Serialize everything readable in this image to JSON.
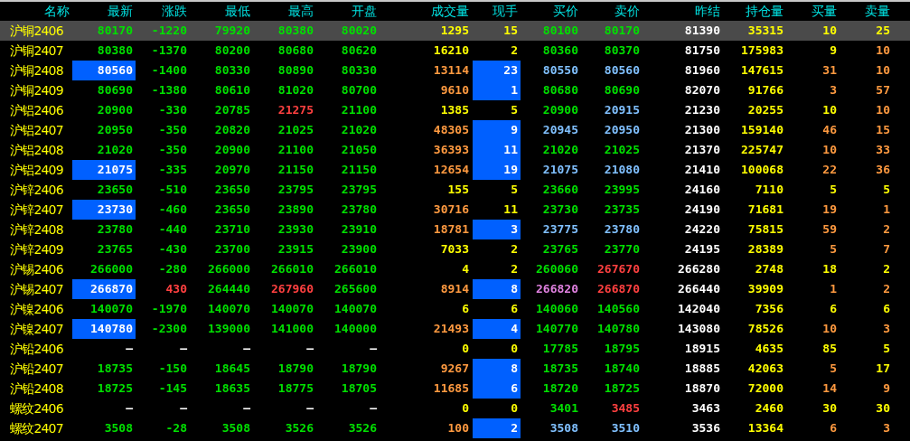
{
  "columns": [
    "名称",
    "最新",
    "涨跌",
    "最低",
    "最高",
    "开盘",
    "成交量",
    "现手",
    "买价",
    "卖价",
    "昨结",
    "持仓量",
    "买量",
    "卖量"
  ],
  "rows": [
    {
      "name": "沪铜2406",
      "selected": true,
      "flash_latest": false,
      "flash_volume": false,
      "cells": [
        {
          "text": "80170",
          "color": "#00e000"
        },
        {
          "text": "-1220",
          "color": "#00e000"
        },
        {
          "text": "79920",
          "color": "#00e000"
        },
        {
          "text": "80380",
          "color": "#00e000"
        },
        {
          "text": "80020",
          "color": "#00e000"
        },
        {
          "text": "1295",
          "color": "#ffff00"
        },
        {
          "text": "15",
          "color": "#ffff00"
        },
        {
          "text": "80100",
          "color": "#00e000"
        },
        {
          "text": "80170",
          "color": "#00e000"
        },
        {
          "text": "81390",
          "color": "#ffffff"
        },
        {
          "text": "35315",
          "color": "#ffff00"
        },
        {
          "text": "10",
          "color": "#ffff00"
        },
        {
          "text": "25",
          "color": "#ffff00"
        }
      ]
    },
    {
      "name": "沪铜2407",
      "selected": false,
      "flash_latest": false,
      "flash_volume": false,
      "cells": [
        {
          "text": "80380",
          "color": "#00e000"
        },
        {
          "text": "-1370",
          "color": "#00e000"
        },
        {
          "text": "80200",
          "color": "#00e000"
        },
        {
          "text": "80680",
          "color": "#00e000"
        },
        {
          "text": "80620",
          "color": "#00e000"
        },
        {
          "text": "16210",
          "color": "#ffff00"
        },
        {
          "text": "2",
          "color": "#ffff00"
        },
        {
          "text": "80360",
          "color": "#00e000"
        },
        {
          "text": "80370",
          "color": "#00e000"
        },
        {
          "text": "81750",
          "color": "#ffffff"
        },
        {
          "text": "175983",
          "color": "#ffff00"
        },
        {
          "text": "9",
          "color": "#ffff00"
        },
        {
          "text": "10",
          "color": "#ff9a40"
        }
      ]
    },
    {
      "name": "沪铜2408",
      "selected": false,
      "flash_latest": true,
      "flash_volume": true,
      "cells": [
        {
          "text": "80560",
          "color": "#ffffff"
        },
        {
          "text": "-1400",
          "color": "#00e000"
        },
        {
          "text": "80330",
          "color": "#00e000"
        },
        {
          "text": "80890",
          "color": "#00e000"
        },
        {
          "text": "80330",
          "color": "#00e000"
        },
        {
          "text": "13114",
          "color": "#ff9a40"
        },
        {
          "text": "23",
          "color": "#ffffff"
        },
        {
          "text": "80550",
          "color": "#80c0ff"
        },
        {
          "text": "80560",
          "color": "#80c0ff"
        },
        {
          "text": "81960",
          "color": "#ffffff"
        },
        {
          "text": "147615",
          "color": "#ffff00"
        },
        {
          "text": "31",
          "color": "#ff9a40"
        },
        {
          "text": "10",
          "color": "#ff9a40"
        }
      ]
    },
    {
      "name": "沪铜2409",
      "selected": false,
      "flash_latest": false,
      "flash_volume": true,
      "cells": [
        {
          "text": "80690",
          "color": "#00e000"
        },
        {
          "text": "-1380",
          "color": "#00e000"
        },
        {
          "text": "80610",
          "color": "#00e000"
        },
        {
          "text": "81020",
          "color": "#00e000"
        },
        {
          "text": "80700",
          "color": "#00e000"
        },
        {
          "text": "9610",
          "color": "#ff9a40"
        },
        {
          "text": "1",
          "color": "#ffffff"
        },
        {
          "text": "80680",
          "color": "#00e000"
        },
        {
          "text": "80690",
          "color": "#00e000"
        },
        {
          "text": "82070",
          "color": "#ffffff"
        },
        {
          "text": "91766",
          "color": "#ffff00"
        },
        {
          "text": "3",
          "color": "#ff9a40"
        },
        {
          "text": "57",
          "color": "#ff9a40"
        }
      ]
    },
    {
      "name": "沪铝2406",
      "selected": false,
      "flash_latest": false,
      "flash_volume": false,
      "cells": [
        {
          "text": "20900",
          "color": "#00e000"
        },
        {
          "text": "-330",
          "color": "#00e000"
        },
        {
          "text": "20785",
          "color": "#00e000"
        },
        {
          "text": "21275",
          "color": "#ff4040"
        },
        {
          "text": "21100",
          "color": "#00e000"
        },
        {
          "text": "1385",
          "color": "#ffff00"
        },
        {
          "text": "5",
          "color": "#ffff00"
        },
        {
          "text": "20900",
          "color": "#00e000"
        },
        {
          "text": "20915",
          "color": "#80c0ff"
        },
        {
          "text": "21230",
          "color": "#ffffff"
        },
        {
          "text": "20255",
          "color": "#ffff00"
        },
        {
          "text": "10",
          "color": "#ffff00"
        },
        {
          "text": "10",
          "color": "#ff9a40"
        }
      ]
    },
    {
      "name": "沪铝2407",
      "selected": false,
      "flash_latest": false,
      "flash_volume": true,
      "cells": [
        {
          "text": "20950",
          "color": "#00e000"
        },
        {
          "text": "-350",
          "color": "#00e000"
        },
        {
          "text": "20820",
          "color": "#00e000"
        },
        {
          "text": "21025",
          "color": "#00e000"
        },
        {
          "text": "21020",
          "color": "#00e000"
        },
        {
          "text": "48305",
          "color": "#ff9a40"
        },
        {
          "text": "9",
          "color": "#ffffff"
        },
        {
          "text": "20945",
          "color": "#80c0ff"
        },
        {
          "text": "20950",
          "color": "#80c0ff"
        },
        {
          "text": "21300",
          "color": "#ffffff"
        },
        {
          "text": "159140",
          "color": "#ffff00"
        },
        {
          "text": "46",
          "color": "#ff9a40"
        },
        {
          "text": "15",
          "color": "#ff9a40"
        }
      ]
    },
    {
      "name": "沪铝2408",
      "selected": false,
      "flash_latest": false,
      "flash_volume": true,
      "cells": [
        {
          "text": "21020",
          "color": "#00e000"
        },
        {
          "text": "-350",
          "color": "#00e000"
        },
        {
          "text": "20900",
          "color": "#00e000"
        },
        {
          "text": "21100",
          "color": "#00e000"
        },
        {
          "text": "21050",
          "color": "#00e000"
        },
        {
          "text": "36393",
          "color": "#ff9a40"
        },
        {
          "text": "11",
          "color": "#ffffff"
        },
        {
          "text": "21020",
          "color": "#00e000"
        },
        {
          "text": "21025",
          "color": "#00e000"
        },
        {
          "text": "21370",
          "color": "#ffffff"
        },
        {
          "text": "225747",
          "color": "#ffff00"
        },
        {
          "text": "10",
          "color": "#ff9a40"
        },
        {
          "text": "33",
          "color": "#ff9a40"
        }
      ]
    },
    {
      "name": "沪铝2409",
      "selected": false,
      "flash_latest": true,
      "flash_volume": true,
      "cells": [
        {
          "text": "21075",
          "color": "#ffffff"
        },
        {
          "text": "-335",
          "color": "#00e000"
        },
        {
          "text": "20970",
          "color": "#00e000"
        },
        {
          "text": "21150",
          "color": "#00e000"
        },
        {
          "text": "21150",
          "color": "#00e000"
        },
        {
          "text": "12654",
          "color": "#ff9a40"
        },
        {
          "text": "19",
          "color": "#ffffff"
        },
        {
          "text": "21075",
          "color": "#80c0ff"
        },
        {
          "text": "21080",
          "color": "#80c0ff"
        },
        {
          "text": "21410",
          "color": "#ffffff"
        },
        {
          "text": "100068",
          "color": "#ffff00"
        },
        {
          "text": "22",
          "color": "#ff9a40"
        },
        {
          "text": "36",
          "color": "#ff9a40"
        }
      ]
    },
    {
      "name": "沪锌2406",
      "selected": false,
      "flash_latest": false,
      "flash_volume": false,
      "cells": [
        {
          "text": "23650",
          "color": "#00e000"
        },
        {
          "text": "-510",
          "color": "#00e000"
        },
        {
          "text": "23650",
          "color": "#00e000"
        },
        {
          "text": "23795",
          "color": "#00e000"
        },
        {
          "text": "23795",
          "color": "#00e000"
        },
        {
          "text": "155",
          "color": "#ffff00"
        },
        {
          "text": "5",
          "color": "#ffff00"
        },
        {
          "text": "23660",
          "color": "#00e000"
        },
        {
          "text": "23995",
          "color": "#00e000"
        },
        {
          "text": "24160",
          "color": "#ffffff"
        },
        {
          "text": "7110",
          "color": "#ffff00"
        },
        {
          "text": "5",
          "color": "#ffff00"
        },
        {
          "text": "5",
          "color": "#ffff00"
        }
      ]
    },
    {
      "name": "沪锌2407",
      "selected": false,
      "flash_latest": true,
      "flash_volume": false,
      "cells": [
        {
          "text": "23730",
          "color": "#ffffff"
        },
        {
          "text": "-460",
          "color": "#00e000"
        },
        {
          "text": "23650",
          "color": "#00e000"
        },
        {
          "text": "23890",
          "color": "#00e000"
        },
        {
          "text": "23780",
          "color": "#00e000"
        },
        {
          "text": "30716",
          "color": "#ff9a40"
        },
        {
          "text": "11",
          "color": "#ffff00"
        },
        {
          "text": "23730",
          "color": "#00e000"
        },
        {
          "text": "23735",
          "color": "#00e000"
        },
        {
          "text": "24190",
          "color": "#ffffff"
        },
        {
          "text": "71681",
          "color": "#ffff00"
        },
        {
          "text": "19",
          "color": "#ff9a40"
        },
        {
          "text": "1",
          "color": "#ff9a40"
        }
      ]
    },
    {
      "name": "沪锌2408",
      "selected": false,
      "flash_latest": false,
      "flash_volume": true,
      "cells": [
        {
          "text": "23780",
          "color": "#00e000"
        },
        {
          "text": "-440",
          "color": "#00e000"
        },
        {
          "text": "23710",
          "color": "#00e000"
        },
        {
          "text": "23930",
          "color": "#00e000"
        },
        {
          "text": "23910",
          "color": "#00e000"
        },
        {
          "text": "18781",
          "color": "#ff9a40"
        },
        {
          "text": "3",
          "color": "#ffffff"
        },
        {
          "text": "23775",
          "color": "#80c0ff"
        },
        {
          "text": "23780",
          "color": "#80c0ff"
        },
        {
          "text": "24220",
          "color": "#ffffff"
        },
        {
          "text": "75815",
          "color": "#ffff00"
        },
        {
          "text": "59",
          "color": "#ff9a40"
        },
        {
          "text": "2",
          "color": "#ff9a40"
        }
      ]
    },
    {
      "name": "沪锌2409",
      "selected": false,
      "flash_latest": false,
      "flash_volume": false,
      "cells": [
        {
          "text": "23765",
          "color": "#00e000"
        },
        {
          "text": "-430",
          "color": "#00e000"
        },
        {
          "text": "23700",
          "color": "#00e000"
        },
        {
          "text": "23915",
          "color": "#00e000"
        },
        {
          "text": "23900",
          "color": "#00e000"
        },
        {
          "text": "7033",
          "color": "#ffff00"
        },
        {
          "text": "2",
          "color": "#ffff00"
        },
        {
          "text": "23765",
          "color": "#00e000"
        },
        {
          "text": "23770",
          "color": "#00e000"
        },
        {
          "text": "24195",
          "color": "#ffffff"
        },
        {
          "text": "28389",
          "color": "#ffff00"
        },
        {
          "text": "5",
          "color": "#ff9a40"
        },
        {
          "text": "7",
          "color": "#ff9a40"
        }
      ]
    },
    {
      "name": "沪锡2406",
      "selected": false,
      "flash_latest": false,
      "flash_volume": false,
      "cells": [
        {
          "text": "266000",
          "color": "#00e000"
        },
        {
          "text": "-280",
          "color": "#00e000"
        },
        {
          "text": "266000",
          "color": "#00e000"
        },
        {
          "text": "266010",
          "color": "#00e000"
        },
        {
          "text": "266010",
          "color": "#00e000"
        },
        {
          "text": "4",
          "color": "#ffff00"
        },
        {
          "text": "2",
          "color": "#ffff00"
        },
        {
          "text": "260060",
          "color": "#00e000"
        },
        {
          "text": "267670",
          "color": "#ff4040"
        },
        {
          "text": "266280",
          "color": "#ffffff"
        },
        {
          "text": "2748",
          "color": "#ffff00"
        },
        {
          "text": "18",
          "color": "#ffff00"
        },
        {
          "text": "2",
          "color": "#ffff00"
        }
      ]
    },
    {
      "name": "沪锡2407",
      "selected": false,
      "flash_latest": true,
      "flash_volume": true,
      "cells": [
        {
          "text": "266870",
          "color": "#ffffff"
        },
        {
          "text": "430",
          "color": "#ff4040"
        },
        {
          "text": "264440",
          "color": "#00e000"
        },
        {
          "text": "267960",
          "color": "#ff4040"
        },
        {
          "text": "265600",
          "color": "#00e000"
        },
        {
          "text": "8914",
          "color": "#ff9a40"
        },
        {
          "text": "8",
          "color": "#ffffff"
        },
        {
          "text": "266820",
          "color": "#e080e0"
        },
        {
          "text": "266870",
          "color": "#ff4040"
        },
        {
          "text": "266440",
          "color": "#ffffff"
        },
        {
          "text": "39909",
          "color": "#ffff00"
        },
        {
          "text": "1",
          "color": "#ff9a40"
        },
        {
          "text": "2",
          "color": "#ff9a40"
        }
      ]
    },
    {
      "name": "沪镍2406",
      "selected": false,
      "flash_latest": false,
      "flash_volume": false,
      "cells": [
        {
          "text": "140070",
          "color": "#00e000"
        },
        {
          "text": "-1970",
          "color": "#00e000"
        },
        {
          "text": "140070",
          "color": "#00e000"
        },
        {
          "text": "140070",
          "color": "#00e000"
        },
        {
          "text": "140070",
          "color": "#00e000"
        },
        {
          "text": "6",
          "color": "#ffff00"
        },
        {
          "text": "6",
          "color": "#ffff00"
        },
        {
          "text": "140060",
          "color": "#00e000"
        },
        {
          "text": "140560",
          "color": "#00e000"
        },
        {
          "text": "142040",
          "color": "#ffffff"
        },
        {
          "text": "7356",
          "color": "#ffff00"
        },
        {
          "text": "6",
          "color": "#ffff00"
        },
        {
          "text": "6",
          "color": "#ffff00"
        }
      ]
    },
    {
      "name": "沪镍2407",
      "selected": false,
      "flash_latest": true,
      "flash_volume": true,
      "cells": [
        {
          "text": "140780",
          "color": "#ffffff"
        },
        {
          "text": "-2300",
          "color": "#00e000"
        },
        {
          "text": "139000",
          "color": "#00e000"
        },
        {
          "text": "141000",
          "color": "#00e000"
        },
        {
          "text": "140000",
          "color": "#00e000"
        },
        {
          "text": "21493",
          "color": "#ff9a40"
        },
        {
          "text": "4",
          "color": "#ffffff"
        },
        {
          "text": "140770",
          "color": "#00e000"
        },
        {
          "text": "140780",
          "color": "#00e000"
        },
        {
          "text": "143080",
          "color": "#ffffff"
        },
        {
          "text": "78526",
          "color": "#ffff00"
        },
        {
          "text": "10",
          "color": "#ff9a40"
        },
        {
          "text": "3",
          "color": "#ff9a40"
        }
      ]
    },
    {
      "name": "沪铅2406",
      "selected": false,
      "flash_latest": false,
      "flash_volume": false,
      "cells": [
        {
          "text": "—",
          "color": "#ffffff"
        },
        {
          "text": "—",
          "color": "#ffffff"
        },
        {
          "text": "—",
          "color": "#ffffff"
        },
        {
          "text": "—",
          "color": "#ffffff"
        },
        {
          "text": "—",
          "color": "#ffffff"
        },
        {
          "text": "0",
          "color": "#ffff00"
        },
        {
          "text": "0",
          "color": "#ffff00"
        },
        {
          "text": "17785",
          "color": "#00e000"
        },
        {
          "text": "18795",
          "color": "#00e000"
        },
        {
          "text": "18915",
          "color": "#ffffff"
        },
        {
          "text": "4635",
          "color": "#ffff00"
        },
        {
          "text": "85",
          "color": "#ffff00"
        },
        {
          "text": "5",
          "color": "#ffff00"
        }
      ]
    },
    {
      "name": "沪铅2407",
      "selected": false,
      "flash_latest": false,
      "flash_volume": true,
      "cells": [
        {
          "text": "18735",
          "color": "#00e000"
        },
        {
          "text": "-150",
          "color": "#00e000"
        },
        {
          "text": "18645",
          "color": "#00e000"
        },
        {
          "text": "18790",
          "color": "#00e000"
        },
        {
          "text": "18790",
          "color": "#00e000"
        },
        {
          "text": "9267",
          "color": "#ff9a40"
        },
        {
          "text": "8",
          "color": "#ffffff"
        },
        {
          "text": "18735",
          "color": "#00e000"
        },
        {
          "text": "18740",
          "color": "#00e000"
        },
        {
          "text": "18885",
          "color": "#ffffff"
        },
        {
          "text": "42063",
          "color": "#ffff00"
        },
        {
          "text": "5",
          "color": "#ff9a40"
        },
        {
          "text": "17",
          "color": "#ffff00"
        }
      ]
    },
    {
      "name": "沪铅2408",
      "selected": false,
      "flash_latest": false,
      "flash_volume": true,
      "cells": [
        {
          "text": "18725",
          "color": "#00e000"
        },
        {
          "text": "-145",
          "color": "#00e000"
        },
        {
          "text": "18635",
          "color": "#00e000"
        },
        {
          "text": "18775",
          "color": "#00e000"
        },
        {
          "text": "18705",
          "color": "#00e000"
        },
        {
          "text": "11685",
          "color": "#ff9a40"
        },
        {
          "text": "6",
          "color": "#ffffff"
        },
        {
          "text": "18720",
          "color": "#00e000"
        },
        {
          "text": "18725",
          "color": "#00e000"
        },
        {
          "text": "18870",
          "color": "#ffffff"
        },
        {
          "text": "72000",
          "color": "#ffff00"
        },
        {
          "text": "14",
          "color": "#ff9a40"
        },
        {
          "text": "9",
          "color": "#ff9a40"
        }
      ]
    },
    {
      "name": "螺纹2406",
      "selected": false,
      "flash_latest": false,
      "flash_volume": false,
      "cells": [
        {
          "text": "—",
          "color": "#ffffff"
        },
        {
          "text": "—",
          "color": "#ffffff"
        },
        {
          "text": "—",
          "color": "#ffffff"
        },
        {
          "text": "—",
          "color": "#ffffff"
        },
        {
          "text": "—",
          "color": "#ffffff"
        },
        {
          "text": "0",
          "color": "#ffff00"
        },
        {
          "text": "0",
          "color": "#ffff00"
        },
        {
          "text": "3401",
          "color": "#00e000"
        },
        {
          "text": "3485",
          "color": "#ff4040"
        },
        {
          "text": "3463",
          "color": "#ffffff"
        },
        {
          "text": "2460",
          "color": "#ffff00"
        },
        {
          "text": "30",
          "color": "#ffff00"
        },
        {
          "text": "30",
          "color": "#ffff00"
        }
      ]
    },
    {
      "name": "螺纹2407",
      "selected": false,
      "flash_latest": false,
      "flash_volume": true,
      "cells": [
        {
          "text": "3508",
          "color": "#00e000"
        },
        {
          "text": "-28",
          "color": "#00e000"
        },
        {
          "text": "3508",
          "color": "#00e000"
        },
        {
          "text": "3526",
          "color": "#00e000"
        },
        {
          "text": "3526",
          "color": "#00e000"
        },
        {
          "text": "100",
          "color": "#ff9a40"
        },
        {
          "text": "2",
          "color": "#ffffff"
        },
        {
          "text": "3508",
          "color": "#80c0ff"
        },
        {
          "text": "3510",
          "color": "#80c0ff"
        },
        {
          "text": "3536",
          "color": "#ffffff"
        },
        {
          "text": "13364",
          "color": "#ffff00"
        },
        {
          "text": "6",
          "color": "#ff9a40"
        },
        {
          "text": "3",
          "color": "#ff9a40"
        }
      ]
    }
  ]
}
